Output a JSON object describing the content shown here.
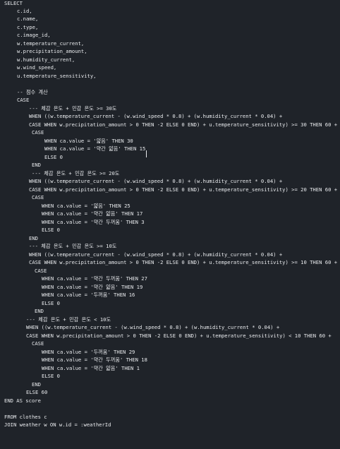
{
  "editor": {
    "lines": [
      "SELECT",
      "c.id,",
      "c.name,",
      "c.type,",
      "c.image_id,",
      "w.temperature_current,",
      "w.precipitation_amount,",
      "w.humidity_current,",
      "w.wind_speed,",
      "u.temperature_sensitivity,",
      "",
      "-- 점수 계산",
      "CASE",
      "--- 체감 온도 + 민감 온도 >= 30도",
      "WHEN ((w.temperature_current - (w.wind_speed * 0.8) + (w.humidity_current * 0.04) +",
      "CASE WHEN w.precipitation_amount > 0 THEN -2 ELSE 0 END) + u.temperature_sensitivity) >= 30 THEN 60 +",
      "CASE",
      "WHEN ca.value = '얇음' THEN 30",
      "WHEN ca.value = '약간 얇음' THEN 15",
      "ELSE 0",
      "END",
      "--- 체감 온도 + 민감 온도 >= 20도",
      "WHEN ((w.temperature_current - (w.wind_speed * 0.8) + (w.humidity_current * 0.04) +",
      "CASE WHEN w.precipitation_amount > 0 THEN -2 ELSE 0 END) + u.temperature_sensitivity) >= 20 THEN 60 +",
      "CASE",
      "WHEN ca.value = '얇음' THEN 25",
      "WHEN ca.value = '약간 얇음' THEN 17",
      "WHEN ca.value = '약간 두꺼움' THEN 3",
      "ELSE 0",
      "END",
      "--- 체감 온도 + 민감 온도 >= 10도",
      "WHEN ((w.temperature_current - (w.wind_speed * 0.8) + (w.humidity_current * 0.04) +",
      "CASE WHEN w.precipitation_amount > 0 THEN -2 ELSE 0 END) + u.temperature_sensitivity) >= 10 THEN 60 +",
      "CASE",
      "WHEN ca.value = '약간 두꺼움' THEN 27",
      "WHEN ca.value = '약간 얇음' THEN 19",
      "WHEN ca.value = '두꺼움' THEN 16",
      "ELSE 0",
      "END",
      "--- 체감 온도 + 민감 온도 < 10도",
      "WHEN ((w.temperature_current - (w.wind_speed * 0.8) + (w.humidity_current * 0.04) +",
      "CASE WHEN w.precipitation_amount > 0 THEN -2 ELSE 0 END) + u.temperature_sensitivity) < 10 THEN 60 +",
      "CASE",
      "WHEN ca.value = '두꺼움' THEN 29",
      "WHEN ca.value = '약간 두꺼움' THEN 18",
      "WHEN ca.value = '약간 얇음' THEN 1",
      "ELSE 0",
      "END",
      "ELSE 60",
      "END AS score",
      "",
      "FROM clothes c",
      "JOIN weather w ON w.id = :weatherId"
    ]
  }
}
